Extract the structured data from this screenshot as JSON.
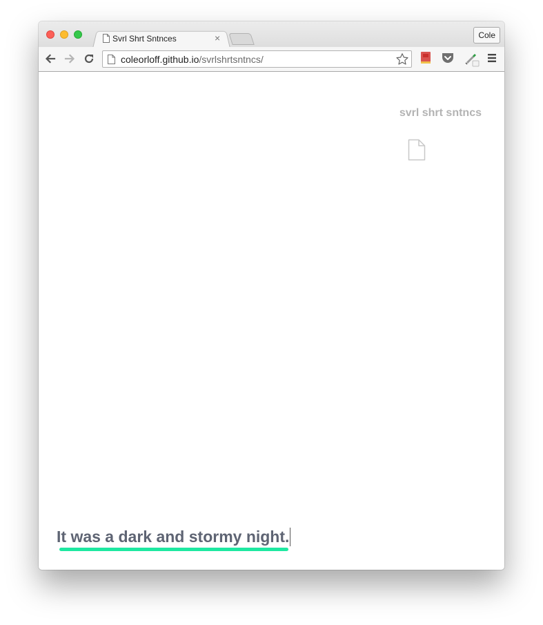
{
  "browser": {
    "tab_title": "Svrl Shrt Sntnces",
    "tab_close": "×",
    "profile_name": "Cole",
    "url_host": "coleorloff.github.io",
    "url_path": "/svrlshrtsntncs/"
  },
  "page": {
    "site_title": "svrl shrt sntncs",
    "sentence": "It was a dark and stormy night.",
    "accent_color": "#1ee8a1",
    "text_color": "#5e6473"
  }
}
